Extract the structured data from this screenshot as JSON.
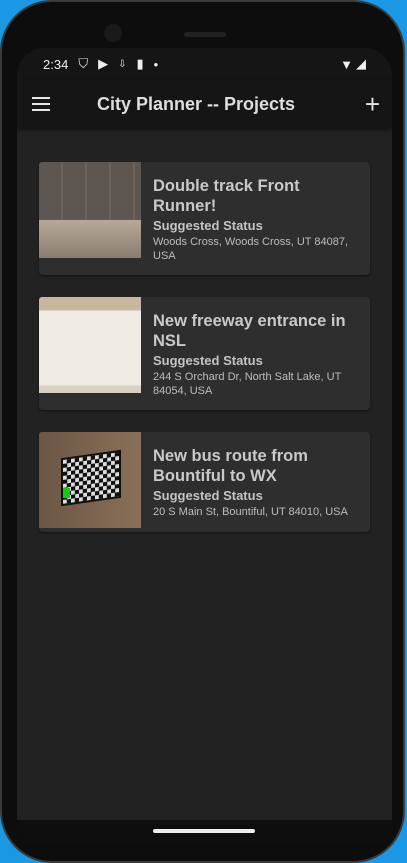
{
  "status_bar": {
    "time": "2:34",
    "icons": [
      "shield-icon",
      "play-protect-icon",
      "download-icon",
      "sd-card-icon",
      "dot-icon",
      "wifi-icon",
      "signal-icon"
    ]
  },
  "app_bar": {
    "title": "City Planner -- Projects",
    "menu_icon": "hamburger-icon",
    "add_icon": "plus-icon",
    "add_label": "+"
  },
  "projects": [
    {
      "title": "Double track Front Runner!",
      "status": "Suggested Status",
      "address": "Woods Cross, Woods Cross, UT 84087, USA"
    },
    {
      "title": "New freeway entrance in NSL",
      "status": "Suggested Status",
      "address": "244 S Orchard Dr, North Salt Lake, UT 84054, USA"
    },
    {
      "title": "New bus route from Bountiful to WX",
      "status": "Suggested Status",
      "address": "20 S Main St, Bountiful, UT 84010, USA"
    }
  ]
}
